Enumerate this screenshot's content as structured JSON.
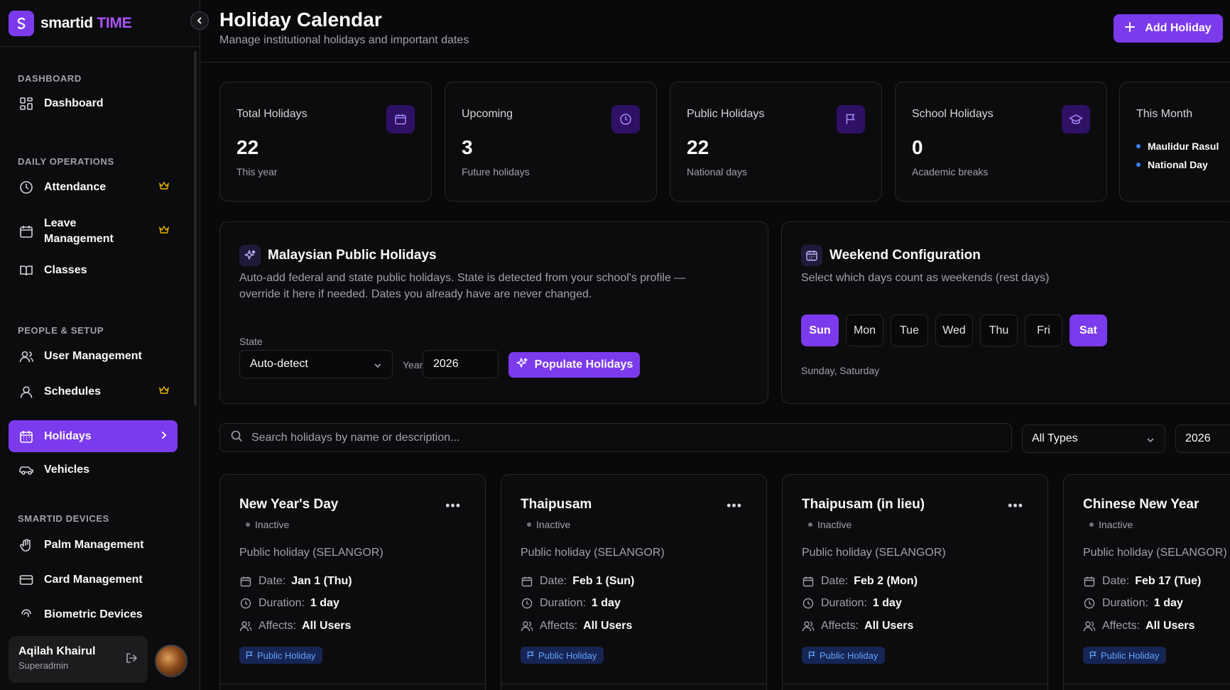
{
  "brand": {
    "name_part1": "smartid",
    "name_part2": "TIME"
  },
  "sidebar": {
    "sections": [
      {
        "label": "DASHBOARD"
      },
      {
        "label": "DAILY OPERATIONS"
      },
      {
        "label": "PEOPLE & SETUP"
      },
      {
        "label": "SMARTID DEVICES"
      }
    ],
    "items": [
      {
        "label": "Dashboard",
        "icon": "grid-icon"
      },
      {
        "label": "Attendance",
        "icon": "clock-icon",
        "premium": true
      },
      {
        "label": "Leave Management",
        "icon": "calendar-icon",
        "premium": true
      },
      {
        "label": "Classes",
        "icon": "book-icon"
      },
      {
        "label": "User Management",
        "icon": "users-icon"
      },
      {
        "label": "Schedules",
        "icon": "user-icon",
        "premium": true
      },
      {
        "label": "Holidays",
        "icon": "calendar-icon",
        "active": true
      },
      {
        "label": "Vehicles",
        "icon": "car-icon"
      },
      {
        "label": "Palm Management",
        "icon": "palm-icon"
      },
      {
        "label": "Card Management",
        "icon": "card-icon"
      },
      {
        "label": "Biometric Devices",
        "icon": "fingerprint-icon"
      }
    ],
    "user": {
      "name": "Aqilah Khairul",
      "role": "Superadmin"
    }
  },
  "header": {
    "title": "Holiday Calendar",
    "subtitle": "Manage institutional holidays and important dates",
    "add_button": "Add Holiday"
  },
  "stats": [
    {
      "label": "Total Holidays",
      "value": "22",
      "sub": "This year",
      "icon": "calendar-icon"
    },
    {
      "label": "Upcoming",
      "value": "3",
      "sub": "Future holidays",
      "icon": "clock-icon"
    },
    {
      "label": "Public Holidays",
      "value": "22",
      "sub": "National days",
      "icon": "flag-icon"
    },
    {
      "label": "School Holidays",
      "value": "0",
      "sub": "Academic breaks",
      "icon": "graduation-cap-icon"
    }
  ],
  "this_month": {
    "label": "This Month",
    "items": [
      "Maulidur Rasul",
      "National Day"
    ]
  },
  "public_holidays_panel": {
    "title": "Malaysian Public Holidays",
    "description": "Auto-add federal and state public holidays. State is detected from your school's profile — override it here if needed. Dates you already have are never changed.",
    "state_label": "State",
    "state_value": "Auto-detect",
    "year_label": "Year",
    "year_value": "2026",
    "button": "Populate Holidays"
  },
  "weekend_panel": {
    "title": "Weekend Configuration",
    "description": "Select which days count as weekends (rest days)",
    "days": [
      {
        "label": "Sun",
        "selected": true
      },
      {
        "label": "Mon",
        "selected": false
      },
      {
        "label": "Tue",
        "selected": false
      },
      {
        "label": "Wed",
        "selected": false
      },
      {
        "label": "Thu",
        "selected": false
      },
      {
        "label": "Fri",
        "selected": false
      },
      {
        "label": "Sat",
        "selected": true
      }
    ],
    "selected_text": "Sunday, Saturday"
  },
  "filters": {
    "search_placeholder": "Search holidays by name or description...",
    "type_value": "All Types",
    "year_value": "2026"
  },
  "labels": {
    "date": "Date:",
    "duration": "Duration:",
    "affects": "Affects:"
  },
  "holidays": [
    {
      "name": "New Year's Day",
      "status": "Inactive",
      "description": "Public holiday (SELANGOR)",
      "date": "Jan 1 (Thu)",
      "duration": "1 day",
      "affects": "All Users",
      "type": "Public Holiday"
    },
    {
      "name": "Thaipusam",
      "status": "Inactive",
      "description": "Public holiday (SELANGOR)",
      "date": "Feb 1 (Sun)",
      "duration": "1 day",
      "affects": "All Users",
      "type": "Public Holiday"
    },
    {
      "name": "Thaipusam (in lieu)",
      "status": "Inactive",
      "description": "Public holiday (SELANGOR)",
      "date": "Feb 2 (Mon)",
      "duration": "1 day",
      "affects": "All Users",
      "type": "Public Holiday"
    },
    {
      "name": "Chinese New Year",
      "status": "Inactive",
      "description": "Public holiday (SELANGOR)",
      "date": "Feb 17 (Tue)",
      "duration": "1 day",
      "affects": "All Users",
      "type": "Public Holiday"
    }
  ],
  "colors": {
    "accent": "#7c3aed",
    "background": "#09090b",
    "badge": "#60a5fa",
    "crown": "#eab308"
  }
}
